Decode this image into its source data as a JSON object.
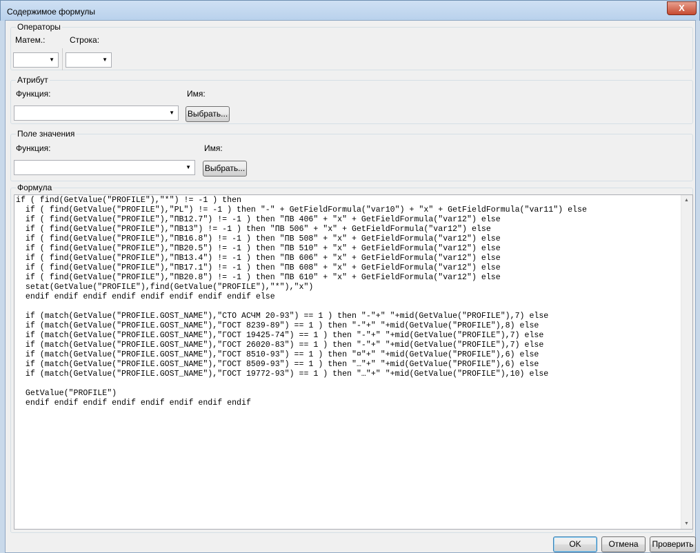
{
  "window": {
    "title": "Содержимое формулы",
    "close_label": "X"
  },
  "operators": {
    "title": "Операторы",
    "math_label": "Матем.:",
    "string_label": "Строка:"
  },
  "attribute": {
    "title": "Атрибут",
    "function_label": "Функция:",
    "name_label": "Имя:",
    "select_button": "Выбрать..."
  },
  "value_field": {
    "title": "Поле значения",
    "function_label": "Функция:",
    "name_label": "Имя:",
    "select_button": "Выбрать..."
  },
  "formula": {
    "title": "Формула",
    "lines": [
      "if ( find(GetValue(\"PROFILE\"),\"*\") != -1 ) then",
      "  if ( find(GetValue(\"PROFILE\"),\"PL\") != -1 ) then \"-\" + GetFieldFormula(\"var10\") + \"x\" + GetFieldFormula(\"var11\") else",
      "  if ( find(GetValue(\"PROFILE\"),\"ПВ12.7\") != -1 ) then \"ПВ 406\" + \"x\" + GetFieldFormula(\"var12\") else",
      "  if ( find(GetValue(\"PROFILE\"),\"ПВ13\") != -1 ) then \"ПВ 506\" + \"x\" + GetFieldFormula(\"var12\") else",
      "  if ( find(GetValue(\"PROFILE\"),\"ПВ16.8\") != -1 ) then \"ПВ 508\" + \"x\" + GetFieldFormula(\"var12\") else",
      "  if ( find(GetValue(\"PROFILE\"),\"ПВ20.5\") != -1 ) then \"ПВ 510\" + \"x\" + GetFieldFormula(\"var12\") else",
      "  if ( find(GetValue(\"PROFILE\"),\"ПВ13.4\") != -1 ) then \"ПВ 606\" + \"x\" + GetFieldFormula(\"var12\") else",
      "  if ( find(GetValue(\"PROFILE\"),\"ПВ17.1\") != -1 ) then \"ПВ 608\" + \"x\" + GetFieldFormula(\"var12\") else",
      "  if ( find(GetValue(\"PROFILE\"),\"ПВ20.8\") != -1 ) then \"ПВ 610\" + \"x\" + GetFieldFormula(\"var12\") else",
      "  setat(GetValue(\"PROFILE\"),find(GetValue(\"PROFILE\"),\"*\"),\"x\")",
      "  endif endif endif endif endif endif endif endif else",
      "",
      "  if (match(GetValue(\"PROFILE.GOST_NAME\"),\"СТО АСЧМ 20-93\") == 1 ) then \"-\"+\" \"+mid(GetValue(\"PROFILE\"),7) else",
      "  if (match(GetValue(\"PROFILE.GOST_NAME\"),\"ГОСТ 8239-89\") == 1 ) then \"-\"+\" \"+mid(GetValue(\"PROFILE\"),8) else",
      "  if (match(GetValue(\"PROFILE.GOST_NAME\"),\"ГОСТ 19425-74\") == 1 ) then \"-\"+\" \"+mid(GetValue(\"PROFILE\"),7) else",
      "  if (match(GetValue(\"PROFILE.GOST_NAME\"),\"ГОСТ 26020-83\") == 1 ) then \"-\"+\" \"+mid(GetValue(\"PROFILE\"),7) else",
      "  if (match(GetValue(\"PROFILE.GOST_NAME\"),\"ГОСТ 8510-93\") == 1 ) then \"¤\"+\" \"+mid(GetValue(\"PROFILE\"),6) else",
      "  if (match(GetValue(\"PROFILE.GOST_NAME\"),\"ГОСТ 8509-93\") == 1 ) then \"…\"+\" \"+mid(GetValue(\"PROFILE\"),6) else",
      "  if (match(GetValue(\"PROFILE.GOST_NAME\"),\"ГОСТ 19772-93\") == 1 ) then \"…\"+\" \"+mid(GetValue(\"PROFILE\"),10) else",
      "",
      "  GetValue(\"PROFILE\")",
      "  endif endif endif endif endif endif endif endif"
    ]
  },
  "buttons": {
    "ok": "OK",
    "cancel": "Отмена",
    "check": "Проверить"
  }
}
